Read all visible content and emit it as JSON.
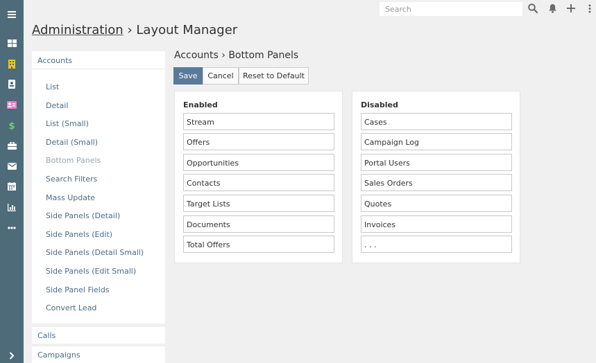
{
  "search": {
    "placeholder": "Search"
  },
  "header": {
    "crumb": "Administration",
    "separator": "›",
    "title": "Layout Manager"
  },
  "sidebar": {
    "group_open": "Accounts",
    "items": [
      {
        "label": "List"
      },
      {
        "label": "Detail"
      },
      {
        "label": "List (Small)"
      },
      {
        "label": "Detail (Small)"
      },
      {
        "label": "Bottom Panels",
        "active": true
      },
      {
        "label": "Search Filters"
      },
      {
        "label": "Mass Update"
      },
      {
        "label": "Side Panels (Detail)"
      },
      {
        "label": "Side Panels (Edit)"
      },
      {
        "label": "Side Panels (Detail Small)"
      },
      {
        "label": "Side Panels (Edit Small)"
      },
      {
        "label": "Side Panel Fields"
      },
      {
        "label": "Convert Lead"
      }
    ],
    "collapsed": [
      {
        "label": "Calls"
      },
      {
        "label": "Campaigns"
      }
    ]
  },
  "main": {
    "title": "Accounts › Bottom Panels",
    "buttons": {
      "save": "Save",
      "cancel": "Cancel",
      "reset": "Reset to Default"
    },
    "enabled": {
      "title": "Enabled",
      "items": [
        "Stream",
        "Offers",
        "Opportunities",
        "Contacts",
        "Target Lists",
        "Documents",
        "Total Offers"
      ]
    },
    "disabled": {
      "title": "Disabled",
      "items": [
        "Cases",
        "Campaign Log",
        "Portal Users",
        "Sales Orders",
        "Quotes",
        "Invoices",
        ". . ."
      ]
    }
  },
  "colors": {
    "rail": "#4e6b7a",
    "primary_button": "#5a7a99",
    "link": "#4a6c8a",
    "rail_icons": [
      "#ffffff",
      "#f0c419",
      "#ffffff",
      "#e87dc9",
      "#6dd26d",
      "#ffffff",
      "#ffffff",
      "#ffffff",
      "#ffffff",
      "#ffffff"
    ]
  },
  "icons": [
    "menu-icon",
    "dashboard-icon",
    "accounts-icon",
    "contacts-icon",
    "leads-icon",
    "opportunities-icon",
    "cases-icon",
    "email-icon",
    "calendar-icon",
    "reports-icon",
    "more-icon",
    "expand-icon",
    "search-icon",
    "bell-icon",
    "plus-icon",
    "kebab-icon"
  ]
}
